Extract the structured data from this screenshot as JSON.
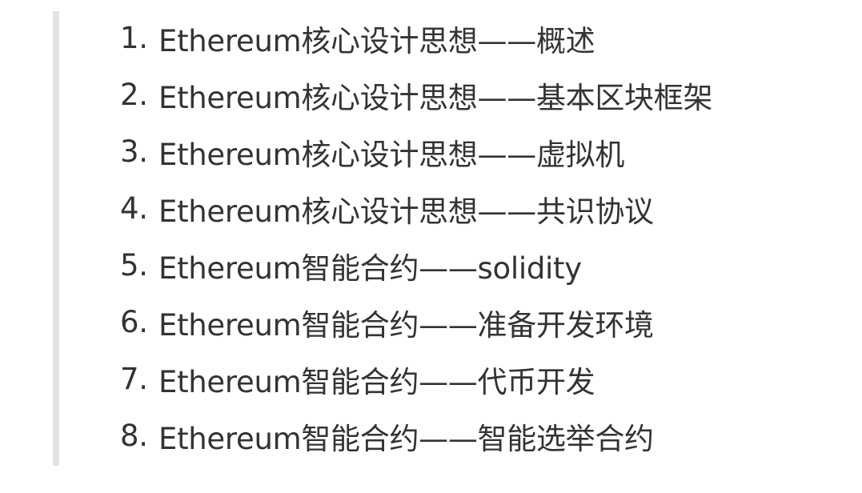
{
  "list": {
    "items": [
      {
        "number": "1.",
        "text": "Ethereum核心设计思想——概述"
      },
      {
        "number": "2.",
        "text": "Ethereum核心设计思想——基本区块框架"
      },
      {
        "number": "3.",
        "text": "Ethereum核心设计思想——虚拟机"
      },
      {
        "number": "4.",
        "text": "Ethereum核心设计思想——共识协议"
      },
      {
        "number": "5.",
        "text": "Ethereum智能合约——solidity"
      },
      {
        "number": "6.",
        "text": "Ethereum智能合约——准备开发环境"
      },
      {
        "number": "7.",
        "text": "Ethereum智能合约——代币开发"
      },
      {
        "number": "8.",
        "text": "Ethereum智能合约——智能选举合约"
      }
    ]
  }
}
